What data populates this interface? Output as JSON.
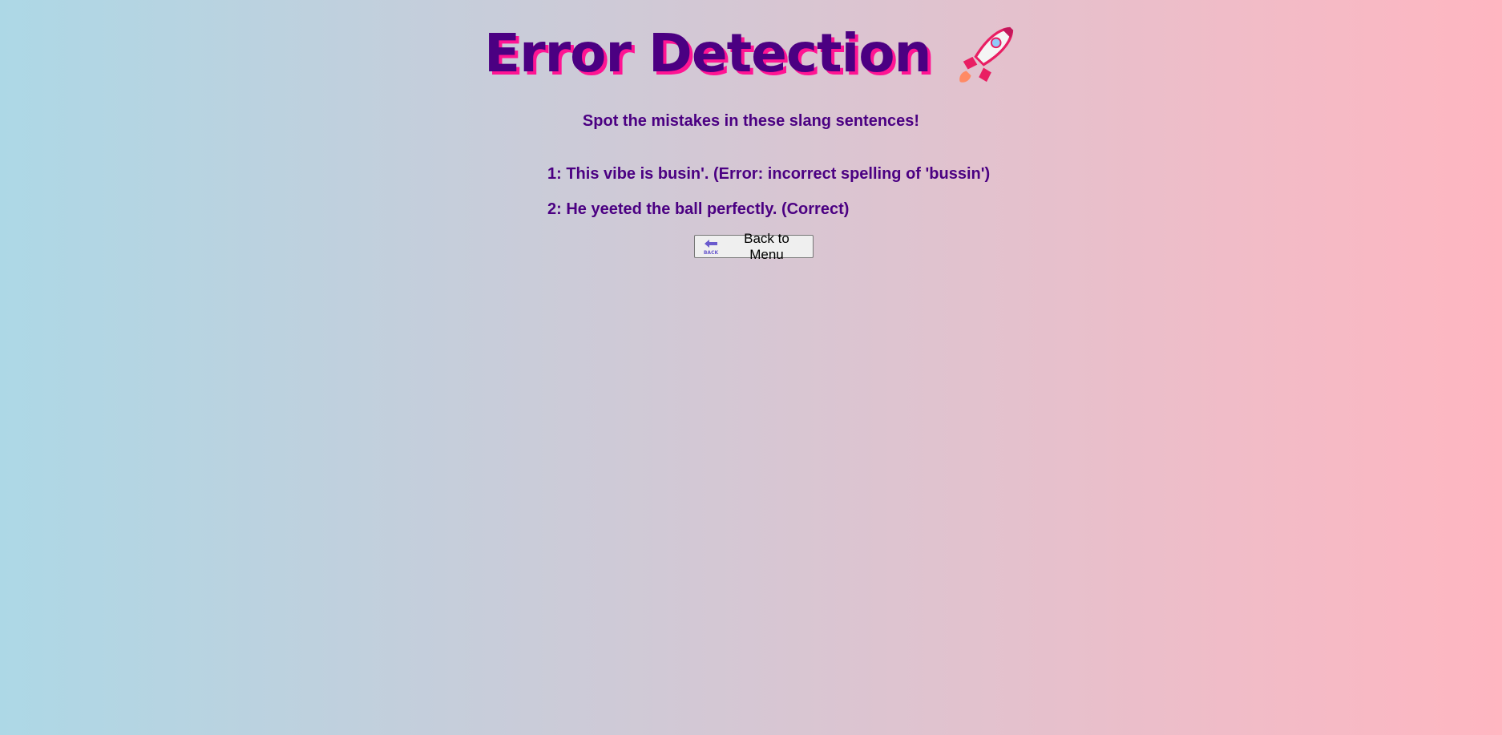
{
  "header": {
    "title": "Error Detection",
    "title_icon": "rocket-icon"
  },
  "subtitle": "Spot the mistakes in these slang sentences!",
  "sentences": [
    {
      "text": "1: This vibe is busin'. (Error: incorrect spelling of 'bussin')"
    },
    {
      "text": "2: He yeeted the ball perfectly. (Correct)"
    }
  ],
  "back_button": {
    "label": "Back to Menu",
    "icon": "back-arrow-icon",
    "icon_text": "BACK"
  },
  "colors": {
    "title": "#4b0082",
    "title_shadow": "#ff1493",
    "gradient_start": "#add8e6",
    "gradient_end": "#ffb6c1"
  }
}
